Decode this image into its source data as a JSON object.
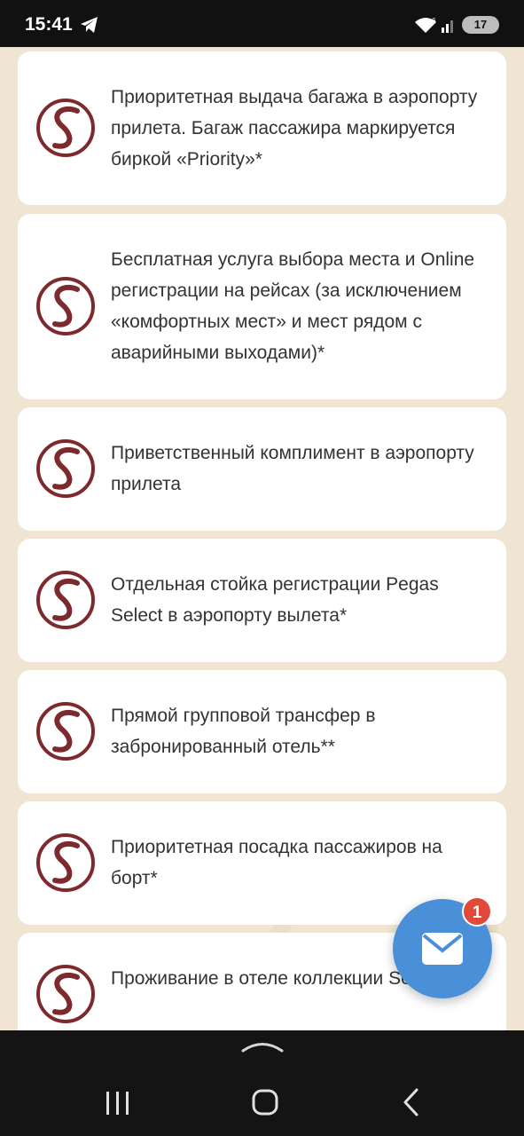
{
  "status_bar": {
    "time": "15:41",
    "battery": "17",
    "icons": [
      "telegram-icon",
      "wifi-icon",
      "signal-icon",
      "battery-icon"
    ]
  },
  "features": [
    {
      "text": "Приоритетная выдача багажа в аэропорту прилета. Багаж пассажира маркируется биркой «Priority»*",
      "icon": "pegas-logo-icon"
    },
    {
      "text": "Бесплатная услуга выбора места и Online регистрации на рейсах (за исключением «комфортных мест» и мест рядом с аварийными выходами)*",
      "icon": "pegas-logo-icon"
    },
    {
      "text": "Приветственный комплимент в аэропорту прилета",
      "icon": "pegas-logo-icon"
    },
    {
      "text": "Отдельная стойка регистрации Pegas Select в аэропорту вылета*",
      "icon": "pegas-logo-icon"
    },
    {
      "text": "Прямой групповой трансфер в забронированный отель**",
      "icon": "pegas-logo-icon"
    },
    {
      "text": "Приоритетная посадка пассажиров на борт*",
      "icon": "pegas-logo-icon"
    },
    {
      "text": "Проживание в отеле коллекции Select",
      "icon": "pegas-logo-icon"
    }
  ],
  "chat_button": {
    "icon": "mail-icon",
    "badge": "1"
  },
  "nav_bar": {
    "icons": [
      "chevron-up-icon",
      "recent-apps-icon",
      "home-icon",
      "back-icon"
    ]
  },
  "colors": {
    "brand": "#7d2a2e",
    "accent": "#4a90d9",
    "badge": "#e04a3a",
    "background": "#efe5d2"
  }
}
